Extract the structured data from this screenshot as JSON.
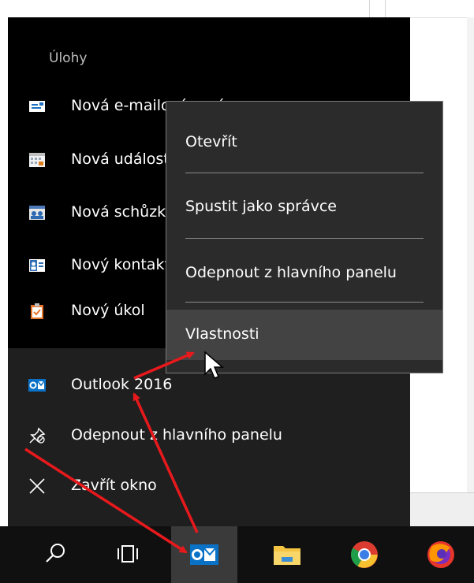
{
  "jumplist": {
    "section_title": "Úlohy",
    "tasks": [
      {
        "label": "Nová e-mailová zpráva",
        "icon": "new-email-icon"
      },
      {
        "label": "Nová událost",
        "icon": "new-appointment-icon"
      },
      {
        "label": "Nová schůzka",
        "icon": "new-meeting-icon"
      },
      {
        "label": "Nový kontakt",
        "icon": "new-contact-icon"
      },
      {
        "label": "Nový úkol",
        "icon": "new-task-icon"
      }
    ],
    "app": {
      "label": "Outlook 2016",
      "icon": "outlook-icon"
    },
    "unpin": {
      "label": "Odepnout z hlavního panelu",
      "icon": "unpin-icon"
    },
    "close": {
      "label": "Zavřít okno",
      "icon": "close-icon"
    }
  },
  "context_menu": {
    "items": [
      {
        "label": "Otevřít"
      },
      {
        "label": "Spustit jako správce"
      },
      {
        "label": "Odepnout z hlavního panelu"
      },
      {
        "label": "Vlastnosti",
        "hovered": true
      }
    ]
  },
  "taskbar": {
    "buttons": [
      {
        "icon": "search-icon"
      },
      {
        "icon": "task-view-icon"
      },
      {
        "icon": "outlook-icon",
        "active": true
      },
      {
        "icon": "file-explorer-icon"
      },
      {
        "icon": "chrome-icon"
      },
      {
        "icon": "firefox-icon"
      }
    ]
  },
  "colors": {
    "jumplist_bg": "#000000",
    "menu_bg": "#2b2b2b",
    "outlook_blue": "#0a72c6",
    "annotation_red": "#e8191c"
  }
}
